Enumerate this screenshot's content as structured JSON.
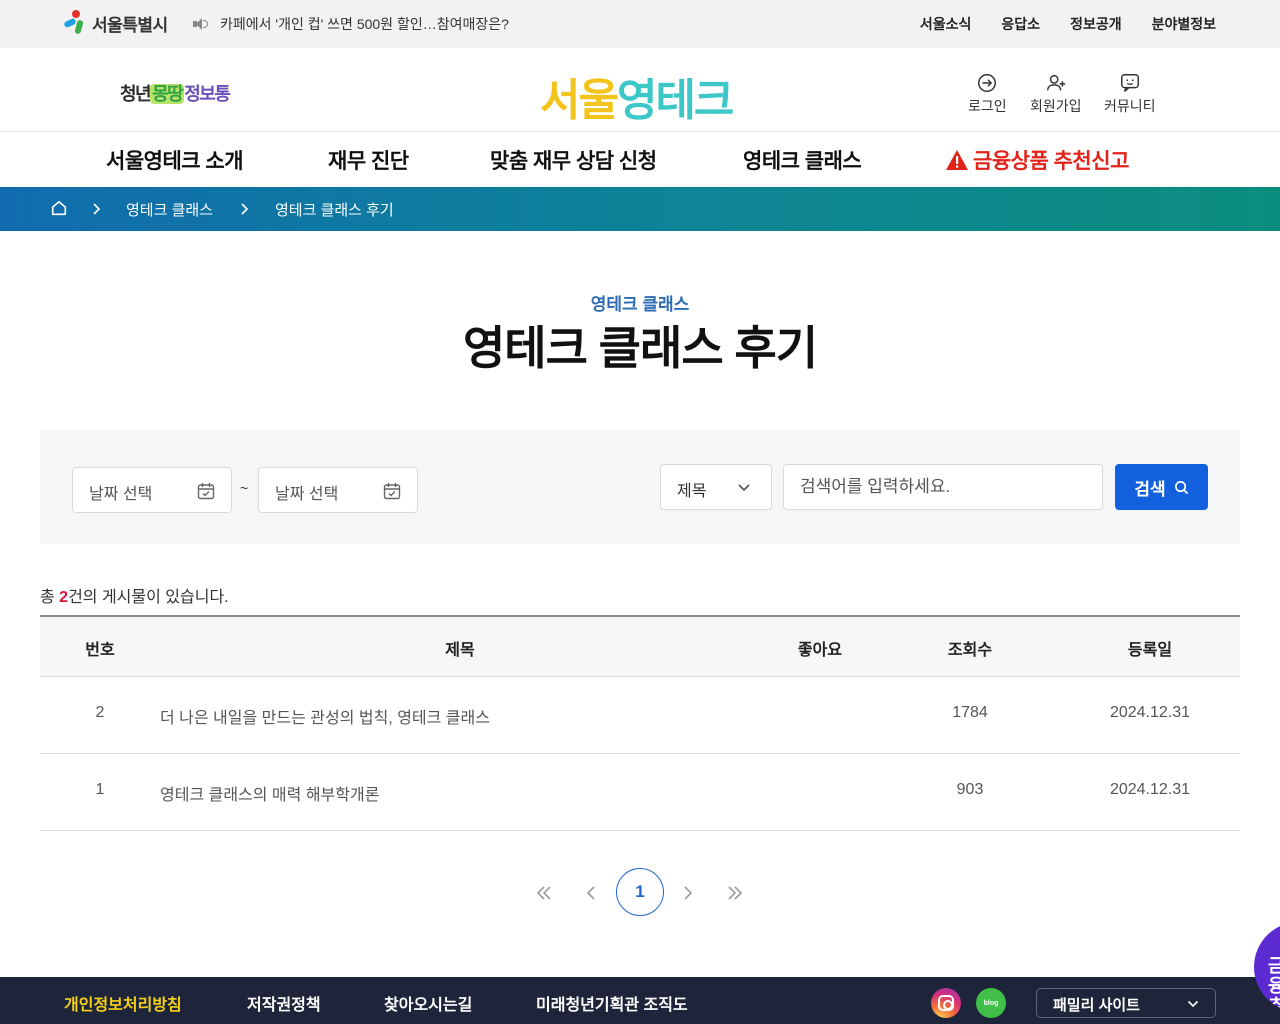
{
  "gov_bar": {
    "logo_text": "서울특별시",
    "notice": "카페에서 '개인 컵' 쓰면 500원 할인…참여매장은?",
    "links": [
      "서울소식",
      "응답소",
      "정보공개",
      "분야별정보"
    ]
  },
  "header": {
    "sub_logo": [
      "청년",
      "몽땅",
      "정보통"
    ],
    "main_logo": [
      "서울",
      "영테크"
    ],
    "utils": [
      "로그인",
      "회원가입",
      "커뮤니티"
    ]
  },
  "gnb": {
    "items": [
      "서울영테크 소개",
      "재무 진단",
      "맞춤 재무 상담 신청",
      "영테크 클래스"
    ],
    "alert_item": "금융상품 추천신고",
    "alert_color": "#e2231a"
  },
  "breadcrumb": {
    "items": [
      "영테크 클래스",
      "영테크 클래스 후기"
    ]
  },
  "page": {
    "category": "영테크 클래스",
    "title": "영테크 클래스 후기"
  },
  "search": {
    "date_start_placeholder": "날짜 선택",
    "date_end_placeholder": "날짜 선택",
    "separator": "~",
    "field_select": "제목",
    "keyword_placeholder": "검색어를 입력하세요.",
    "button_label": "검색",
    "button_color": "#1360de"
  },
  "board": {
    "total_prefix": "총 ",
    "total_count": "2",
    "total_suffix": "건의 게시물이 있습니다.",
    "columns": [
      "번호",
      "제목",
      "좋아요",
      "조회수",
      "등록일"
    ],
    "rows": [
      {
        "no": "2",
        "title": "더 나은 내일을 만드는 관성의 법칙, 영테크 클래스",
        "likes": "",
        "views": "1784",
        "date": "2024.12.31"
      },
      {
        "no": "1",
        "title": "영테크 클래스의 매력 해부학개론",
        "likes": "",
        "views": "903",
        "date": "2024.12.31"
      }
    ]
  },
  "pagination": {
    "current_page": "1"
  },
  "footer": {
    "links": [
      "개인정보처리방침",
      "저작권정책",
      "찾아오시는길",
      "미래청년기획관 조직도"
    ],
    "sns": [
      "instagram-icon",
      "blog-icon"
    ],
    "blog_label": "blog",
    "family_site": "패밀리 사이트"
  },
  "floating": {
    "label": "금융\n추천"
  }
}
